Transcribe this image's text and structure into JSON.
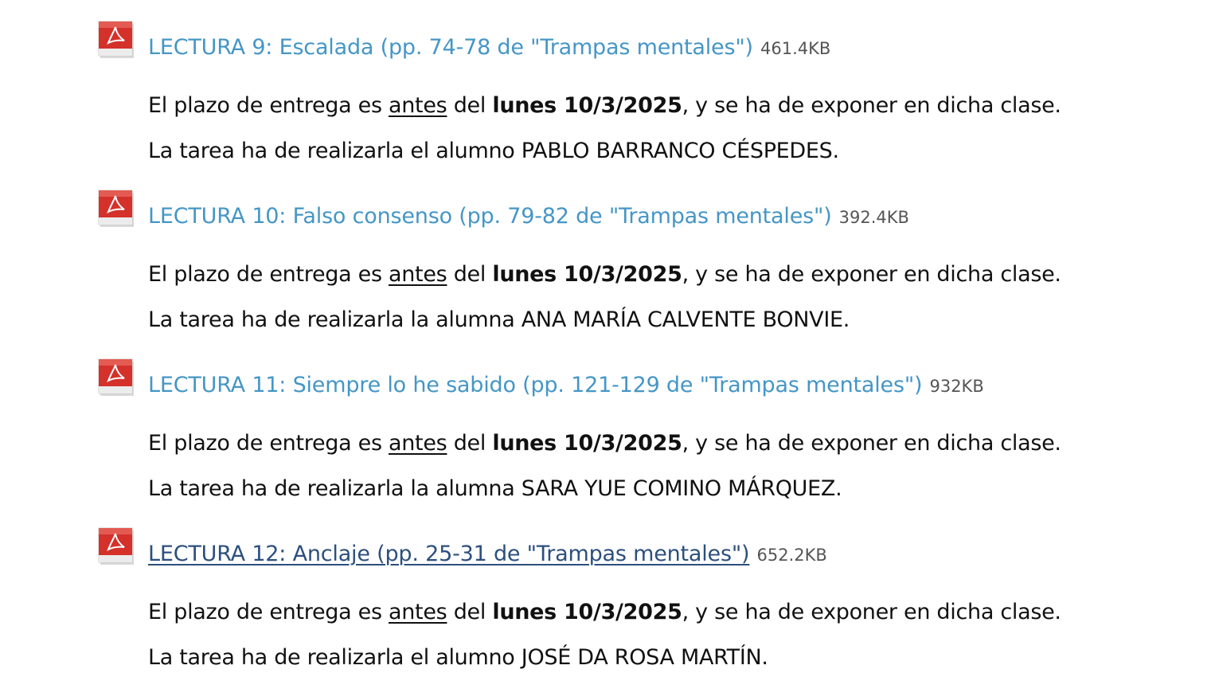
{
  "entries": [
    {
      "title": "LECTURA 9: Escalada (pp. 74-78 de \"Trampas mentales\")",
      "size": "461.4KB",
      "visited": false,
      "deadline": {
        "prefix": "El plazo de entrega es ",
        "emph": "antes",
        "mid": " del ",
        "date": "lunes 10/3/2025",
        "suffix": ", y se ha de exponer en dicha clase."
      },
      "assignee": "La tarea ha de realizarla el alumno PABLO BARRANCO CÉSPEDES."
    },
    {
      "title": "LECTURA 10: Falso consenso (pp. 79-82 de \"Trampas mentales\")",
      "size": "392.4KB",
      "visited": false,
      "deadline": {
        "prefix": "El plazo de entrega es ",
        "emph": "antes",
        "mid": " del ",
        "date": "lunes 10/3/2025",
        "suffix": ", y se ha de exponer en dicha clase."
      },
      "assignee": "La tarea ha de realizarla la alumna ANA MARÍA CALVENTE BONVIE."
    },
    {
      "title": "LECTURA 11: Siempre lo he sabido (pp. 121-129 de \"Trampas mentales\")",
      "size": "932KB",
      "visited": false,
      "deadline": {
        "prefix": "El plazo de entrega es ",
        "emph": "antes",
        "mid": " del ",
        "date": "lunes 10/3/2025",
        "suffix": ", y se ha de exponer en dicha clase."
      },
      "assignee": "La tarea ha de realizarla la alumna SARA YUE COMINO MÁRQUEZ."
    },
    {
      "title": "LECTURA 12: Anclaje (pp. 25-31 de \"Trampas mentales\")",
      "size": "652.2KB",
      "visited": true,
      "deadline": {
        "prefix": "El plazo de entrega es ",
        "emph": "antes",
        "mid": " del ",
        "date": "lunes 10/3/2025",
        "suffix": ", y se ha de exponer en dicha clase."
      },
      "assignee": "La tarea ha de realizarla el alumno JOSÉ DA ROSA MARTÍN."
    }
  ],
  "icon": "pdf-file-icon",
  "colors": {
    "link": "#4596c6",
    "link_visited": "#2c4f7e",
    "file_size": "#555555",
    "pdf_red": "#d4312b"
  }
}
